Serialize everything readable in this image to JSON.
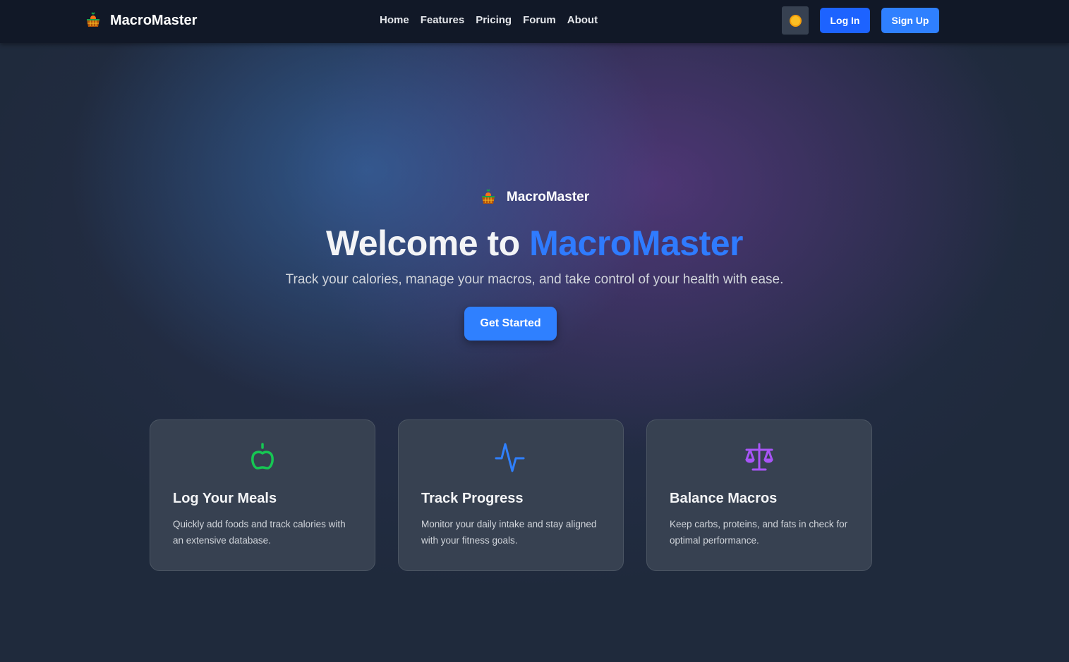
{
  "nav": {
    "brand": "MacroMaster",
    "links": [
      "Home",
      "Features",
      "Pricing",
      "Forum",
      "About"
    ],
    "login": "Log In",
    "signup": "Sign Up",
    "theme_icon": "sun-icon"
  },
  "hero": {
    "brand": "MacroMaster",
    "title_prefix": "Welcome to ",
    "title_accent": "MacroMaster",
    "tagline": "Track your calories, manage your macros, and take control of your health with ease.",
    "cta": "Get Started"
  },
  "colors": {
    "accent": "#2f80ff",
    "apple": "#16c653",
    "pulse": "#2f80ff",
    "scale": "#a855f7"
  },
  "features": [
    {
      "icon": "apple-icon",
      "title": "Log Your Meals",
      "text": "Quickly add foods and track calories with an extensive database."
    },
    {
      "icon": "activity-icon",
      "title": "Track Progress",
      "text": "Monitor your daily intake and stay aligned with your fitness goals."
    },
    {
      "icon": "scale-icon",
      "title": "Balance Macros",
      "text": "Keep carbs, proteins, and fats in check for optimal performance."
    }
  ]
}
